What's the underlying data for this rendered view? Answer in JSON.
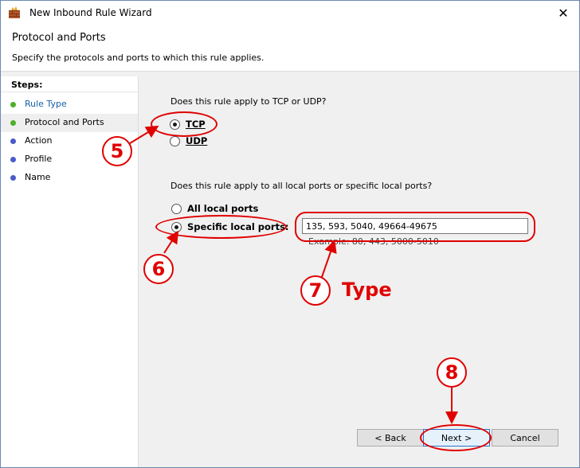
{
  "window": {
    "title": "New Inbound Rule Wizard",
    "close_glyph": "✕"
  },
  "header": {
    "title": "Protocol and Ports",
    "subtitle": "Specify the protocols and ports to which this rule applies."
  },
  "sidebar": {
    "steps_label": "Steps:",
    "items": [
      {
        "label": "Rule Type",
        "state": "done",
        "dot_color": "#4caf2a"
      },
      {
        "label": "Protocol and Ports",
        "state": "current",
        "dot_color": "#4caf2a"
      },
      {
        "label": "Action",
        "state": "pending",
        "dot_color": "#4a5bc9"
      },
      {
        "label": "Profile",
        "state": "pending",
        "dot_color": "#4a5bc9"
      },
      {
        "label": "Name",
        "state": "pending",
        "dot_color": "#4a5bc9"
      }
    ]
  },
  "protocol": {
    "question": "Does this rule apply to TCP or UDP?",
    "tcp_label": "TCP",
    "udp_label": "UDP",
    "selected": "TCP"
  },
  "ports": {
    "question": "Does this rule apply to all local ports or specific local ports?",
    "all_label": "All local ports",
    "specific_label": "Specific local ports:",
    "selected": "specific",
    "value": "135, 593, 5040, 49664-49675",
    "example": "Example: 80, 443, 5000-5010"
  },
  "buttons": {
    "back": "< Back",
    "next": "Next >",
    "cancel": "Cancel"
  },
  "annotations": {
    "color": "#e00000",
    "step5": "5",
    "step6": "6",
    "step7": "7",
    "step7_text": "Type",
    "step8": "8"
  }
}
